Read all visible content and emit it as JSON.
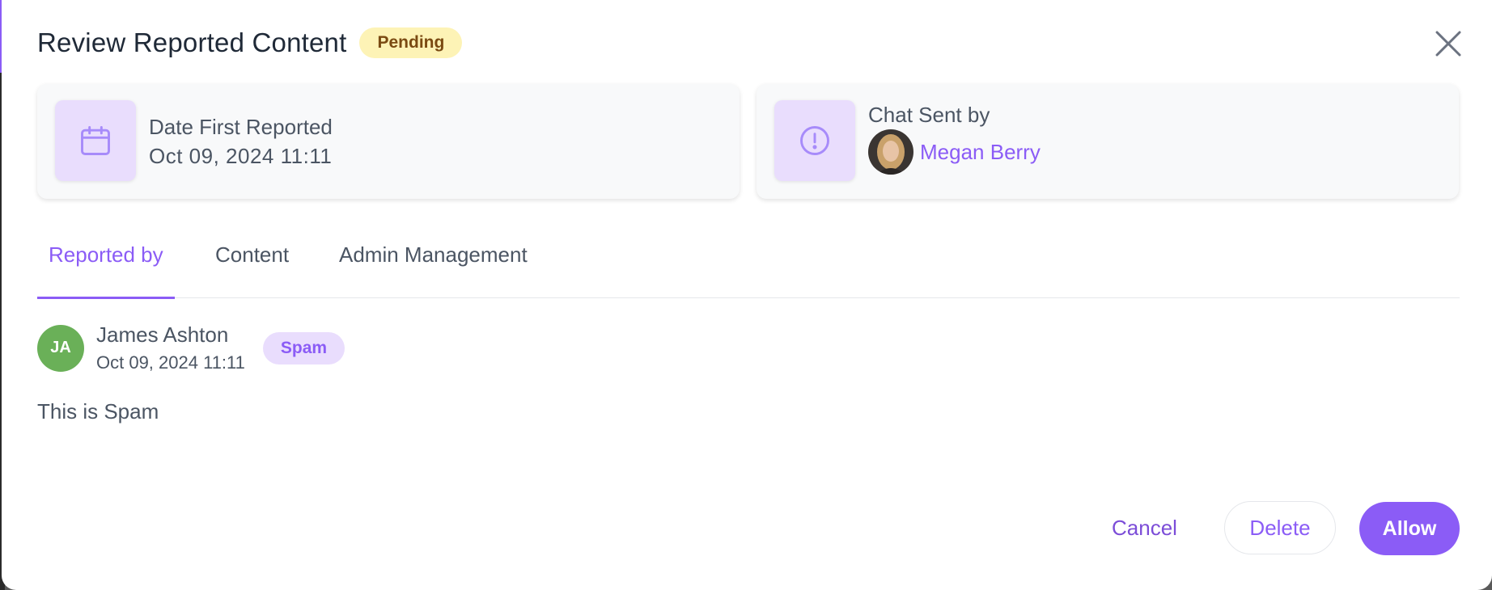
{
  "modal": {
    "title": "Review Reported Content",
    "status": "Pending"
  },
  "info_cards": {
    "date_card": {
      "label": "Date First Reported",
      "value": "Oct 09, 2024 11:11",
      "icon": "calendar-icon"
    },
    "sender_card": {
      "label": "Chat Sent by",
      "sender_name": "Megan Berry",
      "icon": "alert-circle-icon"
    }
  },
  "tabs": [
    {
      "label": "Reported by",
      "active": true
    },
    {
      "label": "Content",
      "active": false
    },
    {
      "label": "Admin Management",
      "active": false
    }
  ],
  "report": {
    "initials": "JA",
    "reporter_name": "James Ashton",
    "date": "Oct 09, 2024 11:11",
    "reason": "Spam",
    "message": "This is Spam"
  },
  "actions": {
    "cancel": "Cancel",
    "delete": "Delete",
    "allow": "Allow"
  },
  "colors": {
    "accent": "#8b5cf6",
    "pending_bg": "#fdf3b6",
    "avatar_green": "#6ab058"
  }
}
